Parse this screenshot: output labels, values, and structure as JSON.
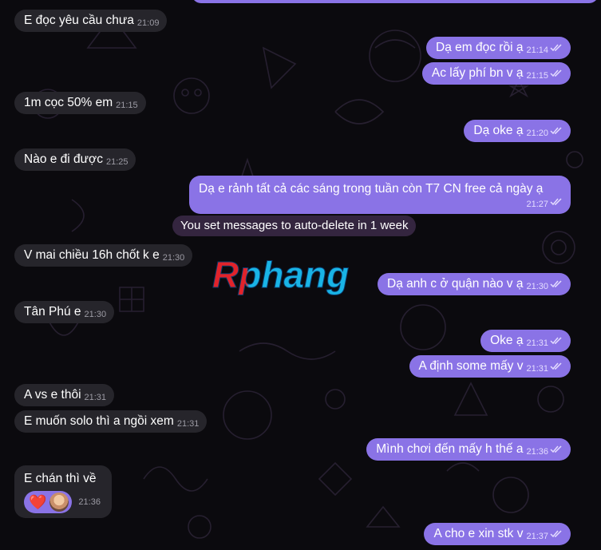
{
  "colors": {
    "background": "#0b0a0e",
    "incoming_bubble": "#26252b",
    "outgoing_bubble": "#8a73e6",
    "service_bubble": "#3c2a48",
    "logo_red": "#e1232b",
    "logo_blue": "#19b4e6"
  },
  "watermark": {
    "text": "Rphang"
  },
  "messages": [
    {
      "dir": "in",
      "text": "E đọc yêu cầu chưa",
      "time": "21:09"
    },
    {
      "dir": "out",
      "text": "Dạ em đọc rồi ạ",
      "time": "21:14"
    },
    {
      "dir": "out",
      "text": "Ac lấy phí bn v ạ",
      "time": "21:15"
    },
    {
      "dir": "in",
      "text": "1m cọc 50% em",
      "time": "21:15"
    },
    {
      "dir": "out",
      "text": "Dạ oke ạ",
      "time": "21:20"
    },
    {
      "dir": "in",
      "text": "Nào e đi được",
      "time": "21:25"
    },
    {
      "dir": "out",
      "text": "Dạ e rảnh tất cả các sáng trong tuần còn T7 CN free cả ngày ạ",
      "time": "21:27"
    },
    {
      "dir": "in",
      "text": "V mai chiều 16h chốt k e",
      "time": "21:30"
    },
    {
      "dir": "out",
      "text": "Dạ anh c ở quận nào v ạ",
      "time": "21:30"
    },
    {
      "dir": "in",
      "text": "Tân Phú e",
      "time": "21:30"
    },
    {
      "dir": "out",
      "text": "Oke ạ",
      "time": "21:31"
    },
    {
      "dir": "out",
      "text": "A định some mấy v",
      "time": "21:31"
    },
    {
      "dir": "in",
      "text": "A vs e thôi",
      "time": "21:31"
    },
    {
      "dir": "in",
      "text": "E muốn solo thì a ngồi xem",
      "time": "21:31"
    },
    {
      "dir": "out",
      "text": "Mình chơi đến mấy h thế a",
      "time": "21:36"
    },
    {
      "dir": "in",
      "text": "E chán thì về",
      "time": "21:36"
    },
    {
      "dir": "out",
      "text": "A cho e xin stk v",
      "time": "21:37"
    }
  ],
  "service": {
    "text": "You set messages to auto-delete in 1 week"
  },
  "reaction": {
    "emoji": "❤️",
    "avatar": "reactor-avatar"
  }
}
